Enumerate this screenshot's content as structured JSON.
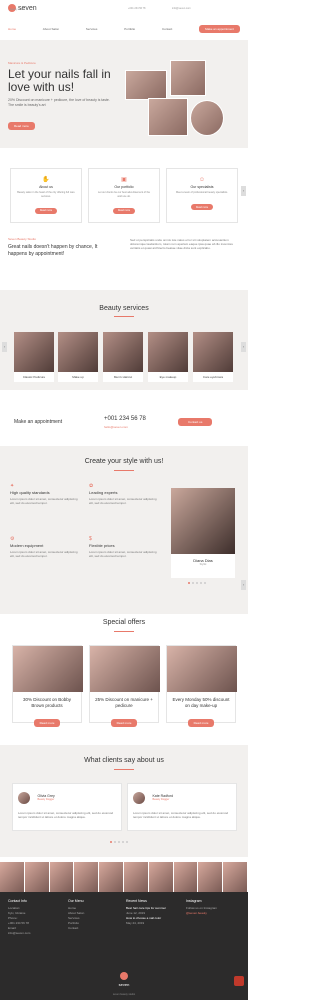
{
  "brand": {
    "name": "seven",
    "tagline": "beauty studio"
  },
  "header": {
    "phone": "+001 234 56 78",
    "email": "info@seven.com"
  },
  "nav": {
    "items": [
      "Home",
      "About Salon",
      "Services",
      "Portfolio",
      "Contact"
    ],
    "cta": "Make an appointment"
  },
  "hero": {
    "tag": "Manicure & Pedicure",
    "title": "Let your nails fall in love with us!",
    "text": "20% Discount on manicure + pedicure, the love of beauty is taste. The smile is beauty's art",
    "button": "Read more"
  },
  "features": [
    {
      "title": "About us",
      "desc": "Beauty salon in the heart of the city offering full care services.",
      "button": "Read more",
      "icon": "hand-icon"
    },
    {
      "title": "Our portfolio",
      "desc": "Let our clients be our best advertisement of the work we do.",
      "button": "Read more",
      "icon": "gallery-icon"
    },
    {
      "title": "Our specialists",
      "desc": "Meet a team of professional beauty specialists.",
      "button": "Read more",
      "icon": "user-icon"
    }
  ],
  "intro": {
    "tag": "Seven Beauty Studio",
    "title": "Great nails doesn't happen by chance, It happens by appointment!",
    "text": "Sed ut perspiciatis unde omnis iste natus error sit voluptatem accusantium doloremque laudantium, totam rem aperiam eaque ipsa quae ab illo inventore veritatis et quasi architecto beatae vitae dicta sunt explicabo."
  },
  "services": {
    "title": "Beauty services",
    "items": [
      "Classic Pedicure",
      "Make up",
      "Men's Haircut",
      "Eye makeup",
      "Care eyebrows"
    ]
  },
  "appointment": {
    "label": "Make an appointment",
    "phone": "+001 234 56 78",
    "email": "hello@seven.com",
    "button": "Contact us"
  },
  "create": {
    "title": "Create your style with us!",
    "items": [
      {
        "title": "High quality standards",
        "text": "Lorem ipsum dolor sit amet, consectetur adipiscing elit, sed do eiusmod tempor."
      },
      {
        "title": "Leading experts",
        "text": "Lorem ipsum dolor sit amet, consectetur adipiscing elit, sed do eiusmod tempor."
      },
      {
        "title": "Modern equipment",
        "text": "Lorem ipsum dolor sit amet, consectetur adipiscing elit, sed do eiusmod tempor."
      },
      {
        "title": "Flexible prices",
        "text": "Lorem ipsum dolor sit amet, consectetur adipiscing elit, sed do eiusmod tempor."
      }
    ],
    "specialist": {
      "name": "Diana Dias",
      "role": "Stylist"
    }
  },
  "offers": {
    "title": "Special offers",
    "items": [
      {
        "label": "30% Discount on Bobby Brown products",
        "button": "Read more"
      },
      {
        "label": "25% Discount on manicure + pedicure",
        "button": "Read more"
      },
      {
        "label": "Every Monday 50% discount on day make-up",
        "button": "Read more"
      }
    ]
  },
  "reviews": {
    "title": "What clients say about us",
    "items": [
      {
        "name": "Olivia Grey",
        "role": "Beauty blogger",
        "text": "Lorem ipsum dolor sit amet, consectetur adipiscing elit, sed do eiusmod tempor incididunt ut labore et dolore magna aliqua."
      },
      {
        "name": "Kate Radford",
        "role": "Beauty blogger",
        "text": "Lorem ipsum dolor sit amet, consectetur adipiscing elit, sed do eiusmod tempor incididunt ut labore et dolore magna aliqua."
      }
    ]
  },
  "footer": {
    "cols": [
      {
        "h": "Contact Info",
        "lines": [
          "Location:",
          "Kyiv, Ukraine",
          "Phone:",
          "+001 234 56 78",
          "Email:",
          "info@seven.com"
        ]
      },
      {
        "h": "Our Menu",
        "lines": [
          "Home",
          "About Salon",
          "Services",
          "Portfolio",
          "Contact"
        ]
      },
      {
        "h": "Recent News",
        "lines": [
          "Best hair care tips for summer",
          "June 12, 2019",
          "How to choose a nail color",
          "May 24, 2019"
        ]
      },
      {
        "h": "Instagram",
        "lines": [
          "Follow us on Instagram",
          "@seven.beauty"
        ]
      }
    ],
    "copyright": "seven beauty studio"
  }
}
